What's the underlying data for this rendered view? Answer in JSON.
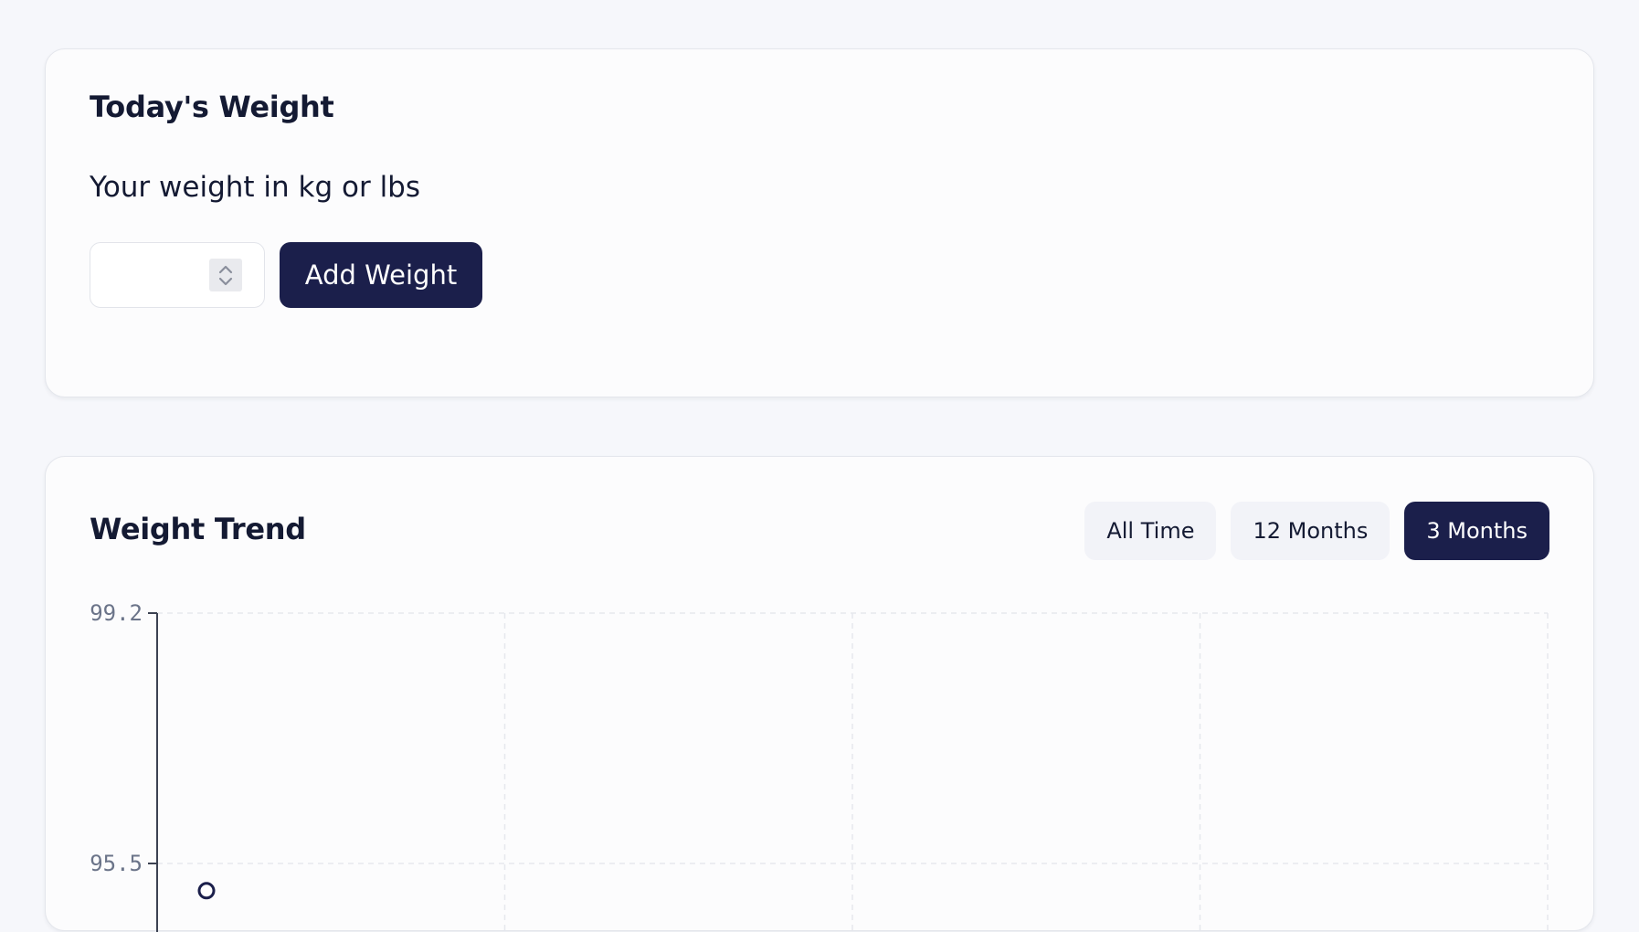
{
  "weight_card": {
    "title": "Today's Weight",
    "input_label": "Your weight in kg or lbs",
    "input_value": "",
    "input_placeholder": "",
    "add_button_label": "Add Weight"
  },
  "trend_card": {
    "title": "Weight Trend",
    "ranges": [
      {
        "label": "All Time",
        "active": false
      },
      {
        "label": "12 Months",
        "active": false
      },
      {
        "label": "3 Months",
        "active": true
      }
    ]
  },
  "colors": {
    "page_background": "#f6f7fb",
    "card_background": "#fcfcfd",
    "primary": "#1b1f4b",
    "inactive_tab": "#f2f3f8",
    "tick_label": "#6b7489",
    "grid": "#e6e8ed"
  },
  "icons": {
    "stepper": "chevron-up-down-icon"
  },
  "chart_data": {
    "type": "line",
    "title": "",
    "xlabel": "",
    "ylabel": "",
    "y_ticks": [
      99.2,
      95.5
    ],
    "ylim": [
      95.5,
      99.2
    ],
    "grid": true,
    "series": [
      {
        "values": [
          95.3
        ]
      }
    ]
  }
}
